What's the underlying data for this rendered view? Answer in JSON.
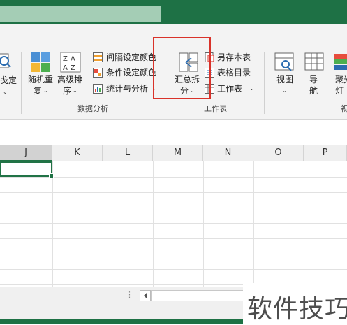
{
  "ribbon": {
    "partial_left_label": "戋定",
    "random_dup": {
      "line1": "随机重",
      "line2": "复"
    },
    "advanced_sort": {
      "line1": "高级排",
      "line2": "序"
    },
    "interval_color": "间隔设定颜色",
    "cond_color": "条件设定颜色",
    "stats_analysis": "统计与分析",
    "group_data_analysis": "数据分析",
    "summary_split": {
      "line1": "汇总拆",
      "line2": "分"
    },
    "save_book": "另存本表",
    "sheet_dir": "表格目录",
    "worksheet": "工作表",
    "group_worksheet": "工作表",
    "view": "视图",
    "nav": {
      "line1": "导",
      "line2": "航"
    },
    "spotlight": {
      "line1": "聚光",
      "line2": "灯"
    },
    "group_partial_right": "视"
  },
  "columns": [
    "J",
    "K",
    "L",
    "M",
    "N",
    "O",
    "P"
  ],
  "watermark": "软件技巧",
  "colors": {
    "excel_green": "#1e7145",
    "highlight_red": "#d9322a",
    "active_cell": "#217346"
  }
}
